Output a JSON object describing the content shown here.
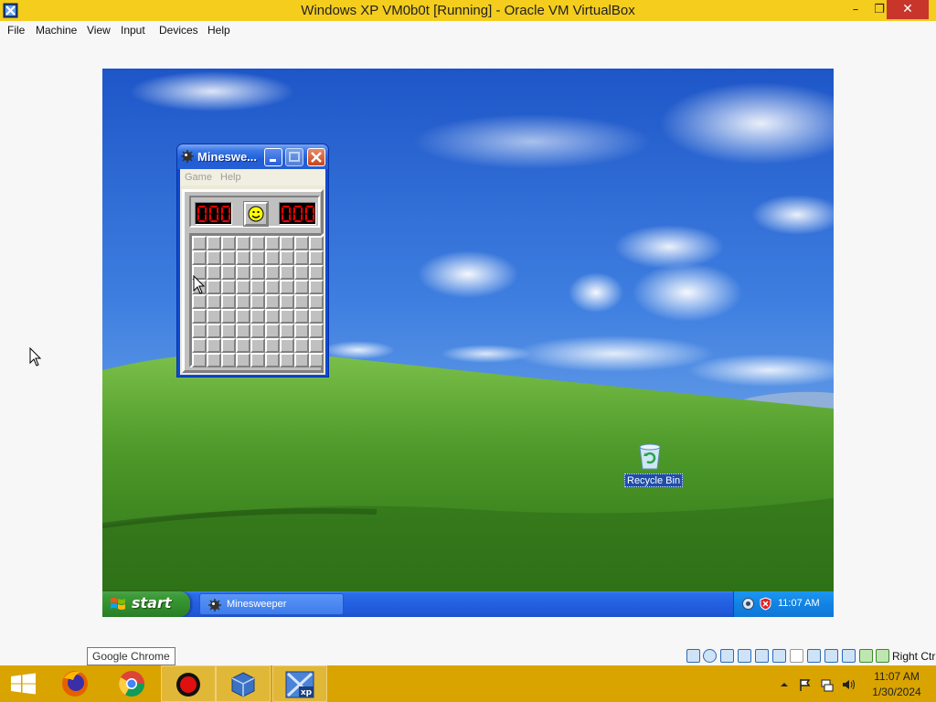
{
  "host_window": {
    "title": "Windows XP VM0b0t [Running] - Oracle VM VirtualBox",
    "controls": {
      "minimize": "–",
      "maximize": "❐",
      "close": "✕"
    },
    "menu": [
      "File",
      "Machine",
      "View",
      "Input",
      "Devices",
      "Help"
    ]
  },
  "guest": {
    "desktop_icons": [
      {
        "label": "Recycle Bin",
        "icon": "recycle-bin-icon"
      }
    ],
    "minesweeper": {
      "title": "Mineswe...",
      "menu": [
        "Game",
        "Help"
      ],
      "mine_counter": "000",
      "timer": "000",
      "face": "smiley",
      "grid": {
        "rows": 9,
        "cols": 9
      }
    },
    "taskbar": {
      "start_label": "start",
      "tasks": [
        {
          "label": "Minesweeper",
          "icon": "minesweeper-icon"
        }
      ],
      "tray_icons": [
        "network-icon",
        "security-shield-icon"
      ],
      "clock": "11:07 AM"
    }
  },
  "tooltip": "Google Chrome",
  "statusbar": {
    "icons": [
      "hard-disk-icon",
      "optical-drive-icon",
      "floppy-icon",
      "audio-icon",
      "network-icon",
      "usb-icon",
      "shared-folders-icon",
      "display-icon",
      "video-capture-icon",
      "cpu-icon",
      "mouse-integration-icon",
      "capture-icon"
    ],
    "host_key": "Right Ctrl"
  },
  "host_taskbar": {
    "apps": [
      "firefox-icon",
      "chrome-icon",
      "record-icon",
      "virtualbox-icon",
      "windows-xp-vm-icon"
    ],
    "tray_icons": [
      "show-hidden-icons-icon",
      "action-center-flag-icon",
      "network-icon",
      "volume-icon"
    ],
    "time": "11:07 AM",
    "date": "1/30/2024"
  },
  "colors": {
    "vbox_titlebar": "#f4cd1d",
    "host_taskbar": "#d9a300",
    "xp_taskbar": "#235fe0",
    "xp_start": "#3c9a37",
    "lcd_red": "#ff0000"
  }
}
